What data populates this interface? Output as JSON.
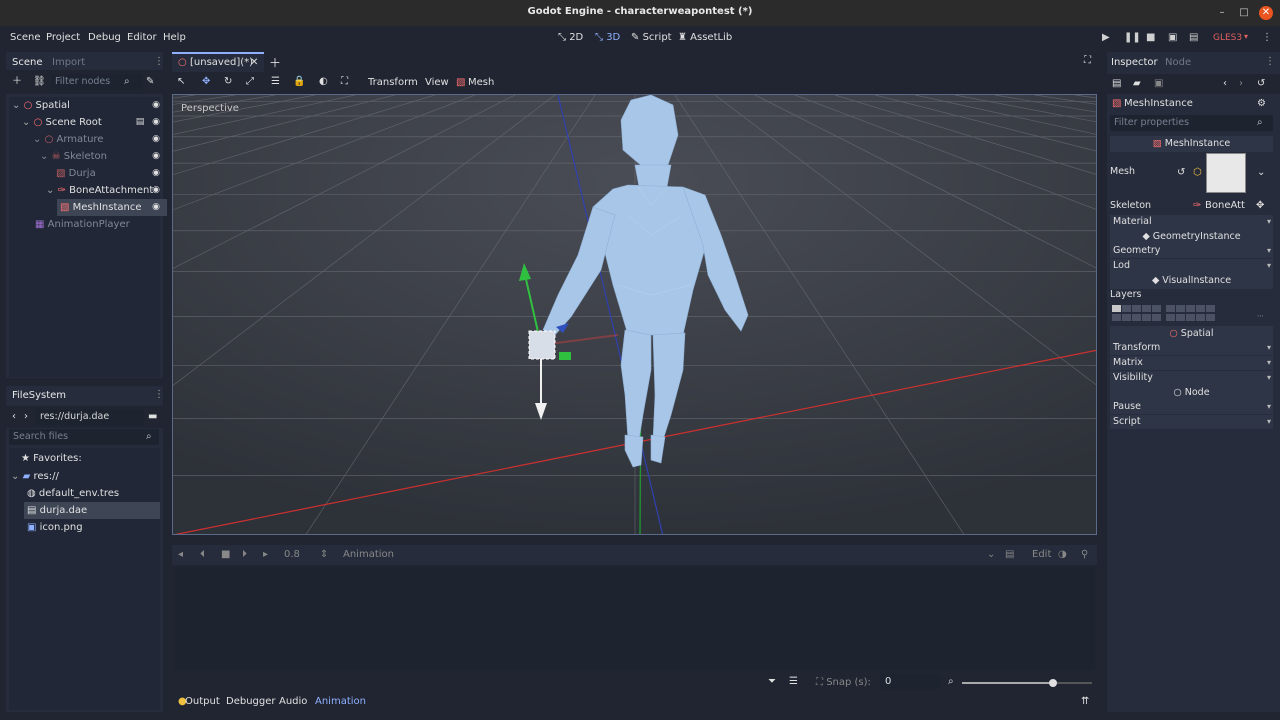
{
  "window": {
    "title": "Godot Engine - characterweapontest (*)"
  },
  "menu": {
    "scene": "Scene",
    "project": "Project",
    "debug": "Debug",
    "editor": "Editor",
    "help": "Help"
  },
  "modes": {
    "m2d": "2D",
    "m3d": "3D",
    "script": "Script",
    "assetlib": "AssetLib"
  },
  "renderer": "GLES3",
  "scene_dock": {
    "tab_scene": "Scene",
    "tab_import": "Import",
    "filter_placeholder": "Filter nodes",
    "nodes": [
      {
        "label": "Spatial",
        "color": "#ff7070"
      },
      {
        "label": "Scene Root",
        "color": "#ff7070"
      },
      {
        "label": "Armature",
        "color": "#ff7070"
      },
      {
        "label": "Skeleton",
        "color": "#ff7070"
      },
      {
        "label": "Durja",
        "color": "#ff7070"
      },
      {
        "label": "BoneAttachment",
        "color": "#ff7070"
      },
      {
        "label": "MeshInstance",
        "color": "#ff7070"
      },
      {
        "label": "AnimationPlayer",
        "color": "#c080ff"
      }
    ]
  },
  "filesystem": {
    "title": "FileSystem",
    "path": "res://durja.dae",
    "search_placeholder": "Search files",
    "favorites": "Favorites:",
    "root": "res://",
    "files": [
      "default_env.tres",
      "durja.dae",
      "icon.png"
    ]
  },
  "editor_tabs": {
    "current": "[unsaved](*)"
  },
  "viewport_toolbar": {
    "transform": "Transform",
    "view": "View",
    "mesh": "Mesh"
  },
  "viewport": {
    "label": "Perspective"
  },
  "animation": {
    "time": "0.8",
    "player_label": "Animation",
    "edit": "Edit",
    "snap_label": "Snap (s):",
    "snap_value": "0",
    "zoom_level": 0.7
  },
  "bottom_tabs": {
    "output": "Output",
    "debugger": "Debugger",
    "audio": "Audio",
    "animation": "Animation"
  },
  "inspector": {
    "tab_inspector": "Inspector",
    "tab_node": "Node",
    "object_name": "MeshInstance",
    "filter_placeholder": "Filter properties",
    "section_meshinstance": "MeshInstance",
    "mesh_label": "Mesh",
    "skeleton_label": "Skeleton",
    "skeleton_value": "BoneAtt",
    "material_label": "Material",
    "section_geometry": "GeometryInstance",
    "geometry_label": "Geometry",
    "lod_label": "Lod",
    "section_visual": "VisualInstance",
    "layers_label": "Layers",
    "section_spatial": "Spatial",
    "transform_label": "Transform",
    "matrix_label": "Matrix",
    "visibility_label": "Visibility",
    "section_node": "Node",
    "pause_label": "Pause",
    "script_label": "Script"
  },
  "colors": {
    "accent": "#8fb0ff",
    "node_red": "#ff7070",
    "selection": "#3e4656"
  }
}
